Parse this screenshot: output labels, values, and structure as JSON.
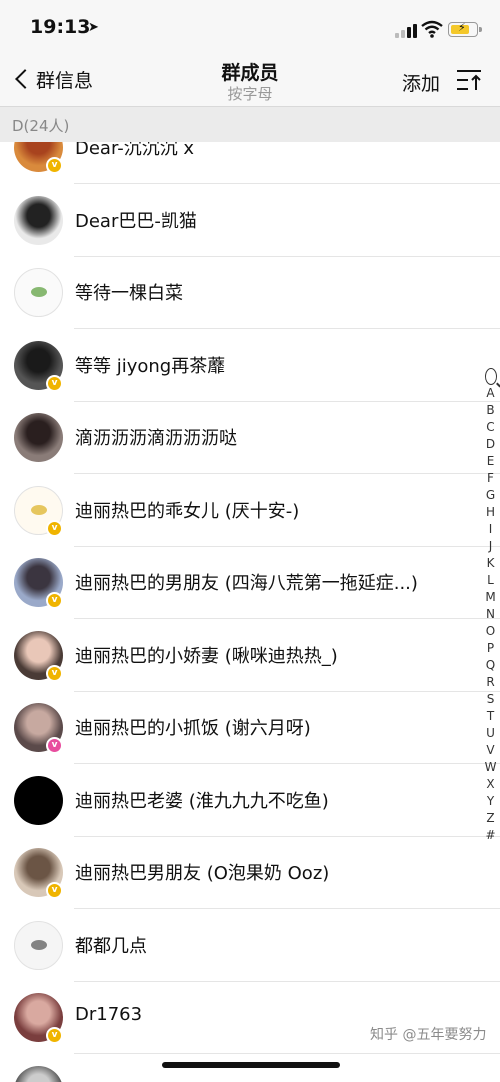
{
  "status_bar": {
    "time": "19:13",
    "location_icon": "location-arrow-icon",
    "signal_icon": "cellular-signal-icon",
    "wifi_icon": "wifi-icon",
    "battery_icon": "battery-charging-icon",
    "battery_color": "#f4c82a"
  },
  "nav": {
    "back_label": "群信息",
    "title": "群成员",
    "subtitle": "按字母",
    "add_label": "添加",
    "sort_icon": "sort-to-top-icon"
  },
  "section": {
    "header": "D(24人)"
  },
  "members": [
    {
      "name": "Dear-沉沉沉 x",
      "badge": "gold",
      "avatar_bg": "#d98a3c",
      "avatar_fg": "#a8431e"
    },
    {
      "name": "Dear巴巴-凯猫",
      "badge": "",
      "avatar_bg": "#e9e9e9",
      "avatar_fg": "#222222"
    },
    {
      "name": "等待一棵白菜",
      "badge": "",
      "avatar_bg": "#fafafa",
      "avatar_fg": "#6aa84f"
    },
    {
      "name": "等等 jiyong再茶蘼",
      "badge": "gold",
      "avatar_bg": "#555555",
      "avatar_fg": "#1a1a1a"
    },
    {
      "name": "滴沥沥沥滴沥沥沥哒",
      "badge": "",
      "avatar_bg": "#8a7c78",
      "avatar_fg": "#2a1f1f"
    },
    {
      "name": "迪丽热巴的乖女儿 (厌十安-)",
      "badge": "gold",
      "avatar_bg": "#fffaf0",
      "avatar_fg": "#e0b93a"
    },
    {
      "name": "迪丽热巴的男朋友 (四海八荒第一拖延症...)",
      "badge": "gold",
      "avatar_bg": "#9aa9c9",
      "avatar_fg": "#3b3540"
    },
    {
      "name": "迪丽热巴的小娇妻 (啾咪迪热热_)",
      "badge": "gold",
      "avatar_bg": "#4a3b36",
      "avatar_fg": "#e9c7b8"
    },
    {
      "name": "迪丽热巴的小抓饭 (谢六月呀)",
      "badge": "pink",
      "avatar_bg": "#5b4a4a",
      "avatar_fg": "#c7a9a0"
    },
    {
      "name": "迪丽热巴老婆 (淮九九九不吃鱼)",
      "badge": "",
      "avatar_bg": "#000000",
      "avatar_fg": "#000000"
    },
    {
      "name": "迪丽热巴男朋友 (O泡果奶 Ooz)",
      "badge": "gold",
      "avatar_bg": "#d8c8b8",
      "avatar_fg": "#6b5545"
    },
    {
      "name": "都都几点",
      "badge": "",
      "avatar_bg": "#f5f5f5",
      "avatar_fg": "#666666"
    },
    {
      "name": "Dr1763",
      "badge": "gold",
      "avatar_bg": "#7a3e3e",
      "avatar_fg": "#d9a9a0"
    },
    {
      "name": "",
      "badge": "",
      "avatar_bg": "#555555",
      "avatar_fg": "#cccccc"
    }
  ],
  "index_letters": [
    "A",
    "B",
    "C",
    "D",
    "E",
    "F",
    "G",
    "H",
    "I",
    "J",
    "K",
    "L",
    "M",
    "N",
    "O",
    "P",
    "Q",
    "R",
    "S",
    "T",
    "U",
    "V",
    "W",
    "X",
    "Y",
    "Z",
    "#"
  ],
  "watermark": "知乎 @五年要努力"
}
